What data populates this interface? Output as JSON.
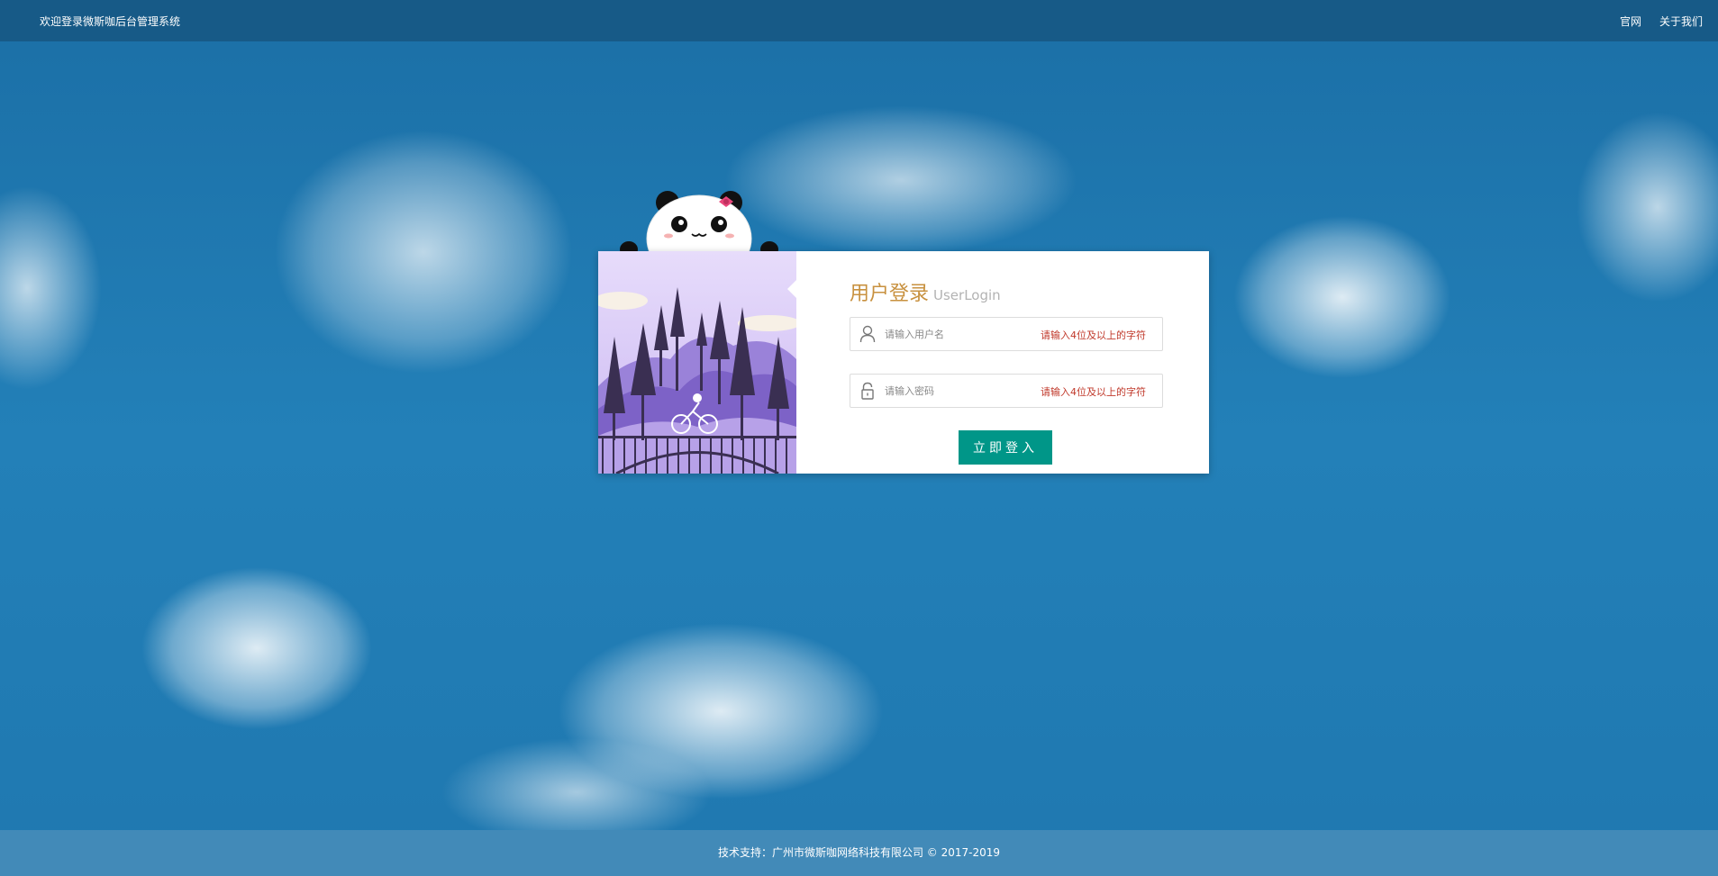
{
  "header": {
    "welcome": "欢迎登录微斯咖后台管理系统",
    "links": [
      {
        "label": "官网"
      },
      {
        "label": "关于我们"
      }
    ]
  },
  "login": {
    "title_cn": "用户登录",
    "title_en": "UserLogin",
    "username": {
      "placeholder": "请输入用户名",
      "value": "",
      "hint": "请输入4位及以上的字符",
      "icon": "user-icon"
    },
    "password": {
      "placeholder": "请输入密码",
      "value": "",
      "hint": "请输入4位及以上的字符",
      "icon": "lock-icon"
    },
    "submit_label": "立即登入"
  },
  "footer": {
    "text": "技术支持：广州市微斯咖网络科技有限公司 © 2017-2019"
  },
  "colors": {
    "topbar": "#175a87",
    "background": "#1f78b0",
    "footer": "#428ab8",
    "title_accent": "#c8913f",
    "hint": "#c0392b",
    "button": "#009688"
  }
}
